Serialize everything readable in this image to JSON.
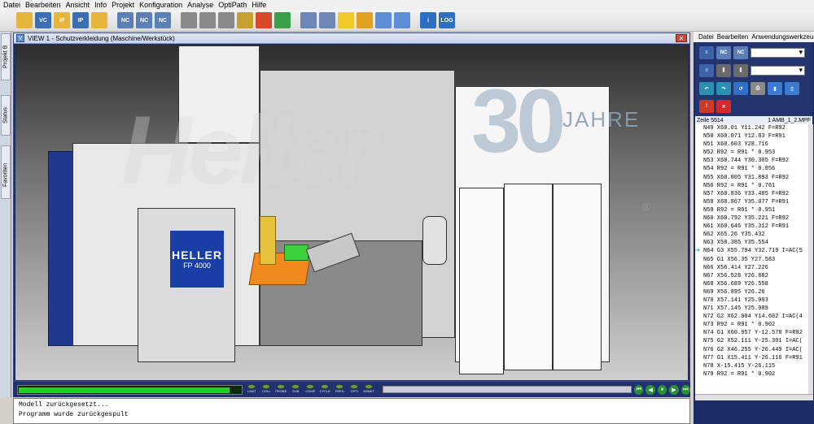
{
  "menu": [
    "Datei",
    "Bearbeiten",
    "Ansicht",
    "Info",
    "Projekt",
    "Konfiguration",
    "Analyse",
    "OptiPath",
    "Hilfe"
  ],
  "toolbar": {
    "buttons": [
      {
        "name": "open-folder-icon",
        "color": "#e7b53c",
        "label": ""
      },
      {
        "name": "save-vc-icon",
        "color": "#3b6fb5",
        "label": "VC"
      },
      {
        "name": "open-ip-icon",
        "color": "#e7b53c",
        "label": "IP"
      },
      {
        "name": "save-ip-icon",
        "color": "#3b6fb5",
        "label": "IP"
      },
      {
        "name": "open-project-icon",
        "color": "#e7b53c",
        "label": ""
      },
      {
        "name": "nc-program-icon",
        "color": "#5d7fb7",
        "label": "NC"
      },
      {
        "name": "nc-edit-icon",
        "color": "#5d7fb7",
        "label": "NC"
      },
      {
        "name": "nc-compare-icon",
        "color": "#5d7fb7",
        "label": "NC"
      },
      {
        "name": "tool-holder-icon",
        "color": "#8a8a8a",
        "label": ""
      },
      {
        "name": "tool-icon",
        "color": "#8a8a8a",
        "label": ""
      },
      {
        "name": "fixture-icon",
        "color": "#8a8a8a",
        "label": ""
      },
      {
        "name": "machine-icon",
        "color": "#c8a030",
        "label": ""
      },
      {
        "name": "stock-icon",
        "color": "#d84a2a",
        "label": ""
      },
      {
        "name": "model-icon",
        "color": "#3aa04a",
        "label": ""
      },
      {
        "name": "view-select-icon",
        "color": "#6f86b8",
        "label": ""
      },
      {
        "name": "view-fit-icon",
        "color": "#6f86b8",
        "label": ""
      },
      {
        "name": "light-bulb-icon",
        "color": "#f2c92a",
        "label": ""
      },
      {
        "name": "rotate-view-icon",
        "color": "#e0a020",
        "label": ""
      },
      {
        "name": "single-view-icon",
        "color": "#5d8ed6",
        "label": ""
      },
      {
        "name": "split-view-icon",
        "color": "#5d8ed6",
        "label": ""
      },
      {
        "name": "info-icon",
        "color": "#2d6fc4",
        "label": "i"
      },
      {
        "name": "log-icon",
        "color": "#2d6fc4",
        "label": "LOG"
      }
    ]
  },
  "left_tabs": [
    "Projekt B",
    "Status",
    "Favoriten"
  ],
  "view": {
    "title": "VIEW 1 - Schutzverkleidung (Maschine/Werkstück)",
    "machine_brand": "HELLER",
    "machine_model": "FP 4000",
    "watermark_30": "30",
    "watermark_jahre": "JAHRE",
    "registered": "®"
  },
  "controls": {
    "progress": 0.9,
    "buttons": [
      "LIMIT",
      "COLL",
      "PROBE",
      "SUB",
      "COMP",
      "CYCLE",
      "FEED",
      "OPTI",
      "NSNKT"
    ]
  },
  "messages": [
    "Modell zurückgesetzt...",
    "Programm wurde zurückgespult"
  ],
  "right_panel": {
    "menu": [
      "Datei",
      "Bearbeiten",
      "Anwendungswerkzeuge"
    ],
    "zeile_label": "Zeile 5514",
    "file_label": "1  AMB_1_2.MPF",
    "nc_lines": [
      "N49 X60.01 Y11.242 F=R92",
      "N50 X60.071 Y12.83 F=R91",
      "N51 X60.603 Y28.716",
      "N52 R92 = R91 * 0.953",
      "N53 X60.744 Y30.305 F=R92",
      "N54 R92 = R91 * 0.856",
      "N55 X60.805 Y31.893 F=R92",
      "N56 R92 = R91 * 0.761",
      "N57 X60.836 Y33.485 F=R92",
      "N58 X60.867 Y35.077 F=R91",
      "N59 R92 = R91 * 0.951",
      "N60 X60.792 Y35.221 F=R92",
      "N61 X60.646 Y35.312 F=R91",
      "N62 X65.26 Y35.432",
      "N63 X58.385 Y35.554",
      "N64 G3 X55.794 Y32.719 I=AC(5",
      "N65 G1 X56.35 Y27.583",
      "N66 X56.414 Y27.226",
      "N67 X56.528 Y26.882",
      "N68 X56.689 Y26.558",
      "N69 X56.895 Y26.26",
      "N70 X57.141 Y25.993",
      "N71 X57.145 Y25.989",
      "N72 G2 X62.004 Y14.602 I=AC(4",
      "N73 R92 = R91 * 0.902",
      "N74 G1 X60.957 Y-12.578 F=R92",
      "N75 G2 X52.111 Y-25.301 I=AC(",
      "N76 G2 X46.255 Y-26.449 I=AC(",
      "N77 G1 X15.411 Y-26.116 F=R91",
      "N78 X-15.415 Y-26.115",
      "N79 R92 = R91 * 0.902"
    ],
    "current_line_index": 15
  }
}
